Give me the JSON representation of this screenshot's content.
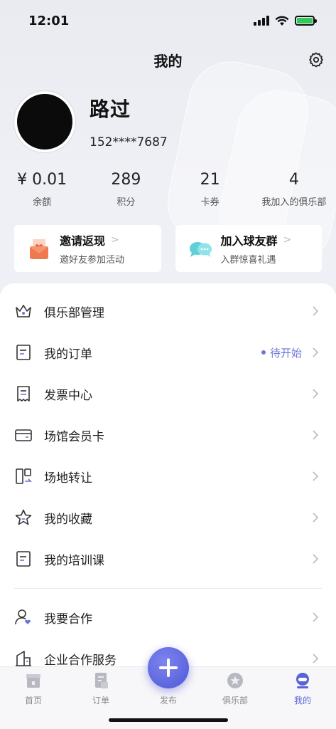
{
  "status_bar": {
    "time": "12:01"
  },
  "header": {
    "title": "我的"
  },
  "profile": {
    "nickname": "路过",
    "phone": "152****7687"
  },
  "stats": [
    {
      "value": "¥ 0.01",
      "label": "余额"
    },
    {
      "value": "289",
      "label": "积分"
    },
    {
      "value": "21",
      "label": "卡券"
    },
    {
      "value": "4",
      "label": "我加入的俱乐部"
    }
  ],
  "promos": [
    {
      "title": "邀请返现",
      "subtitle": "邀好友参加活动",
      "icon": "gift-envelope-icon"
    },
    {
      "title": "加入球友群",
      "subtitle": "入群惊喜礼遇",
      "icon": "chat-bubbles-icon"
    }
  ],
  "menu": {
    "items": [
      {
        "label": "俱乐部管理",
        "icon": "crown-icon"
      },
      {
        "label": "我的订单",
        "icon": "order-doc-icon",
        "status": "待开始"
      },
      {
        "label": "发票中心",
        "icon": "receipt-icon"
      },
      {
        "label": "场馆会员卡",
        "icon": "card-icon"
      },
      {
        "label": "场地转让",
        "icon": "transfer-icon"
      },
      {
        "label": "我的收藏",
        "icon": "star-icon"
      },
      {
        "label": "我的培训课",
        "icon": "course-doc-icon"
      },
      {
        "label": "我要合作",
        "icon": "user-heart-icon"
      },
      {
        "label": "企业合作服务",
        "icon": "building-icon"
      }
    ]
  },
  "tabbar": {
    "tabs": [
      {
        "label": "首页"
      },
      {
        "label": "订单"
      },
      {
        "label": "发布"
      },
      {
        "label": "俱乐部"
      },
      {
        "label": "我的"
      }
    ],
    "active_color": "#5b63d8"
  }
}
